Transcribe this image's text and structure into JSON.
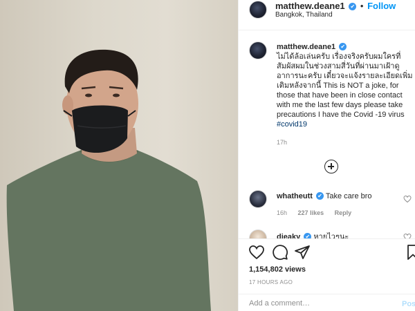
{
  "post": {
    "username": "matthew.deane1",
    "verified_badge": "✔",
    "separator": "•",
    "follow_label": "Follow",
    "location": "Bangkok, Thailand"
  },
  "caption": {
    "username": "matthew.deane1",
    "text_thai": "ไม่ได้ล้อเล่นครับ เรื่องจริงครับผมใครที่สัมผัสผมในช่วงสามสี่วันที่ผ่านมาเฝ้าดูอาการนะครับ เดี๋ยวจะแจ้งรายละเอียดเพิ่มเติมหลังจากนี้",
    "text_english": " This is NOT a joke, for those that have been in close contact with me the last few days please take precautions I have the Covid -19 virus ",
    "hashtag": "#covid19",
    "time": "17h"
  },
  "comments": [
    {
      "username": "whatheutt",
      "text": "Take care bro",
      "time": "16h",
      "likes": "227 likes",
      "reply_label": "Reply"
    },
    {
      "username": "dieaky",
      "text": "หายไวๆนะ"
    }
  ],
  "stats": {
    "views": "1,154,802 views",
    "posted": "17 HOURS AGO"
  },
  "add_comment": {
    "placeholder": "Add a comment…",
    "post_label": "Post"
  },
  "icons": {
    "like": "heart-icon",
    "comment": "comment-icon",
    "share": "share-icon",
    "save": "bookmark-icon",
    "load_more": "plus-circle-icon"
  },
  "colors": {
    "accent": "#0095f6",
    "verified": "#3897f0",
    "hashtag": "#00376b",
    "muted": "#8e8e8e",
    "shirt": "#647560",
    "mask": "#1b1c1e"
  }
}
